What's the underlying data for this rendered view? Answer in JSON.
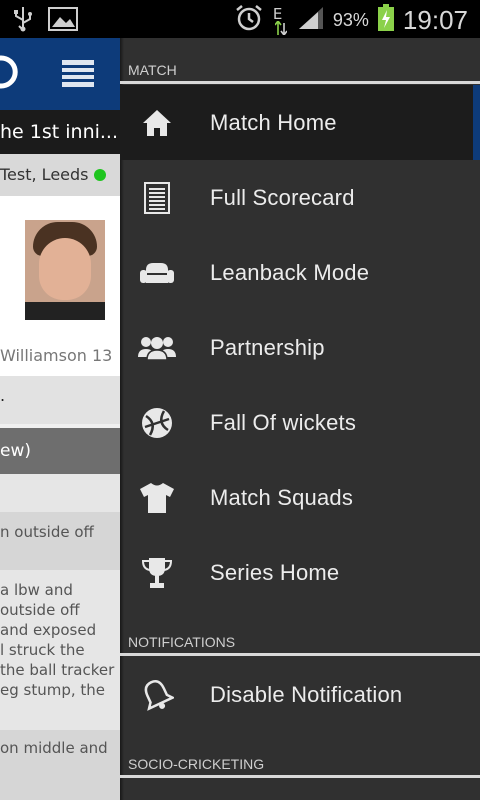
{
  "status_bar": {
    "battery_percent": "93%",
    "network_type": "E",
    "time": "19:07"
  },
  "background_page": {
    "title_fragment": "he 1st inni...",
    "venue_fragment": "Test, Leeds",
    "player_name_fragment": "Williamson 13",
    "row_fragment": ".",
    "grey_bar_fragment": "ew)",
    "commentary": [
      [
        "n outside off"
      ],
      [
        " a lbw and",
        "outside off",
        "and exposed",
        "l struck the",
        "the ball tracker",
        "eg stump, the"
      ],
      [
        "on middle and"
      ]
    ]
  },
  "drawer": {
    "sections": [
      {
        "header": "MATCH",
        "items": [
          {
            "label": "Match Home",
            "icon": "home-icon",
            "active": true
          },
          {
            "label": "Full Scorecard",
            "icon": "scorecard-icon"
          },
          {
            "label": "Leanback Mode",
            "icon": "sofa-icon"
          },
          {
            "label": "Partnership",
            "icon": "group-icon"
          },
          {
            "label": "Fall Of wickets",
            "icon": "ball-icon"
          },
          {
            "label": "Match Squads",
            "icon": "tshirt-icon"
          },
          {
            "label": "Series Home",
            "icon": "trophy-icon"
          }
        ]
      },
      {
        "header": "NOTIFICATIONS",
        "items": [
          {
            "label": "Disable Notification",
            "icon": "bell-icon"
          }
        ]
      },
      {
        "header": "SOCIO-CRICKETING",
        "items": []
      }
    ]
  },
  "colors": {
    "drawer_bg": "#303030",
    "active_item_bg": "#1c1c1c",
    "brand_blue": "#0d3b7a",
    "live_dot": "#1fc51f"
  }
}
